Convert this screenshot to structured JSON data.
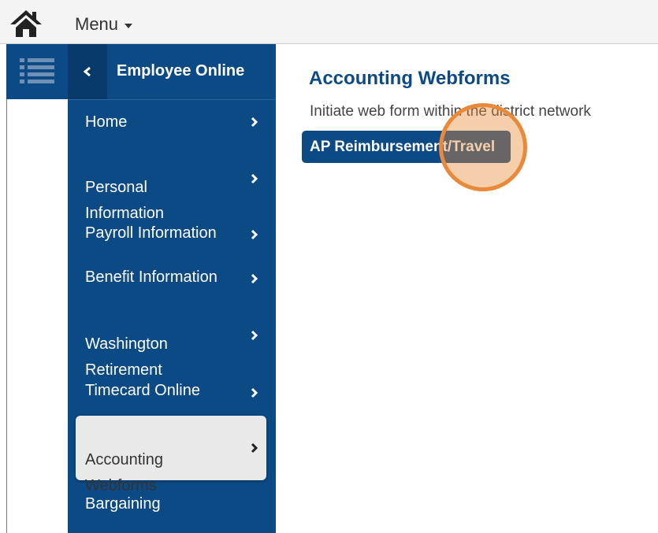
{
  "topbar": {
    "home_icon": "home-icon",
    "menu_label": "Menu"
  },
  "sidebar": {
    "header_title": "Employee Online",
    "items": [
      {
        "label": "Home"
      },
      {
        "label": "Personal\nInformation"
      },
      {
        "label": "Payroll Information"
      },
      {
        "label": "Benefit Information"
      },
      {
        "label": "Washington\nRetirement"
      },
      {
        "label": "Timecard Online"
      },
      {
        "label": "Accounting\nWebforms",
        "active": true
      },
      {
        "label": "Bargaining"
      }
    ]
  },
  "main": {
    "title": "Accounting Webforms",
    "description": "Initiate web form within the district network",
    "button_label": "AP Reimbursement/Travel"
  },
  "colors": {
    "primary": "#0c4a86",
    "accent": "#e88a3a",
    "active_bg": "#e9e9e9"
  }
}
